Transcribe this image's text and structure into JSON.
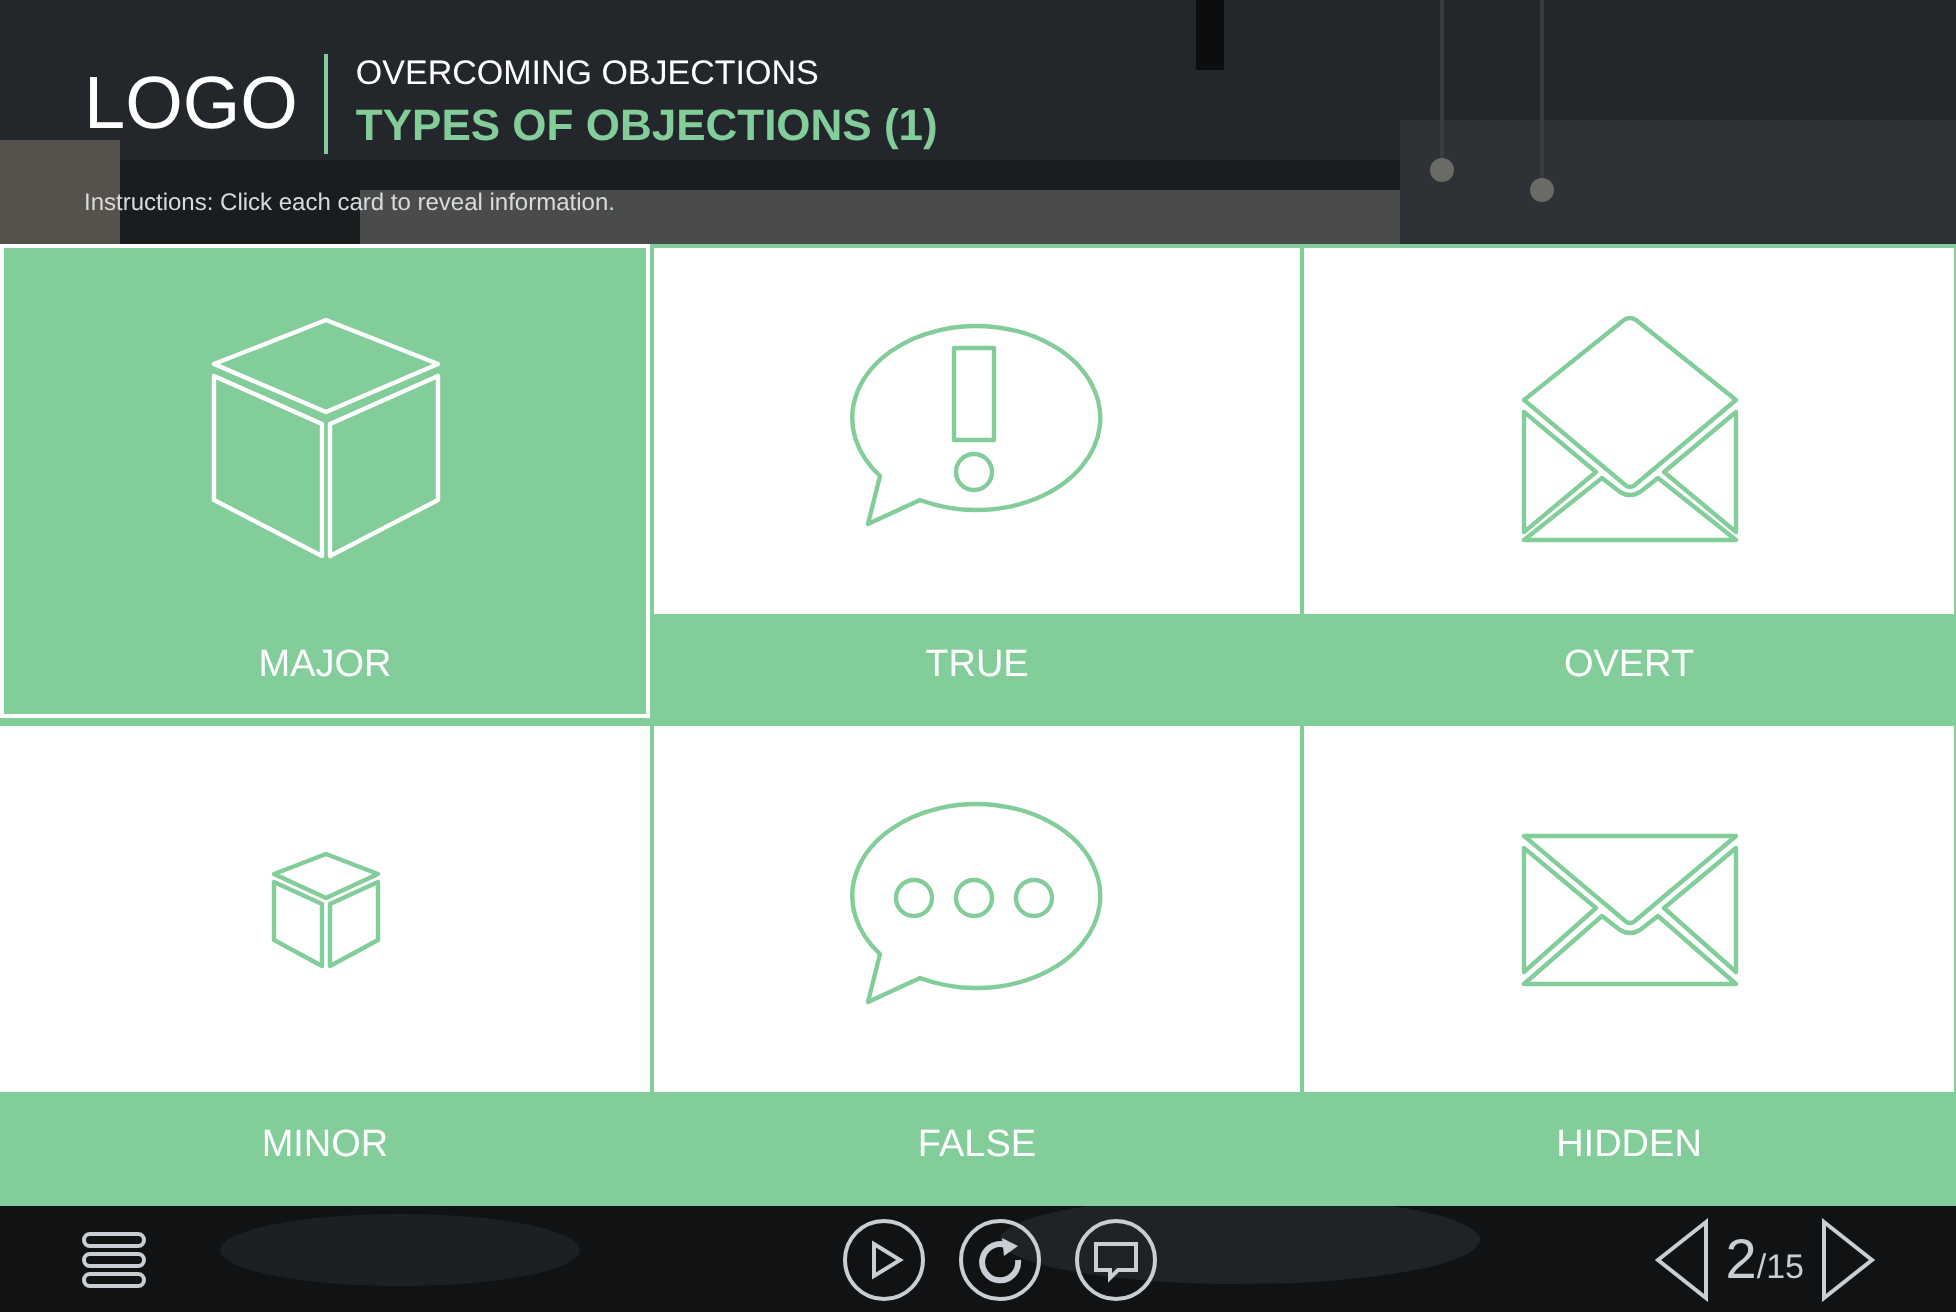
{
  "header": {
    "logo": "LOGO",
    "course_title": "OVERCOMING OBJECTIONS",
    "slide_title": "TYPES OF OBJECTIONS (1)",
    "instructions": "Instructions: Click each card to reveal information."
  },
  "cards": [
    {
      "label": "MAJOR",
      "kind": "cube",
      "selected": true
    },
    {
      "label": "TRUE",
      "kind": "exclaim",
      "selected": false
    },
    {
      "label": "OVERT",
      "kind": "envelope-open",
      "selected": false
    },
    {
      "label": "MINOR",
      "kind": "small-cube",
      "selected": false
    },
    {
      "label": "FALSE",
      "kind": "dots",
      "selected": false
    },
    {
      "label": "HIDDEN",
      "kind": "envelope",
      "selected": false
    }
  ],
  "footer": {
    "page": "2",
    "total": "/15"
  }
}
